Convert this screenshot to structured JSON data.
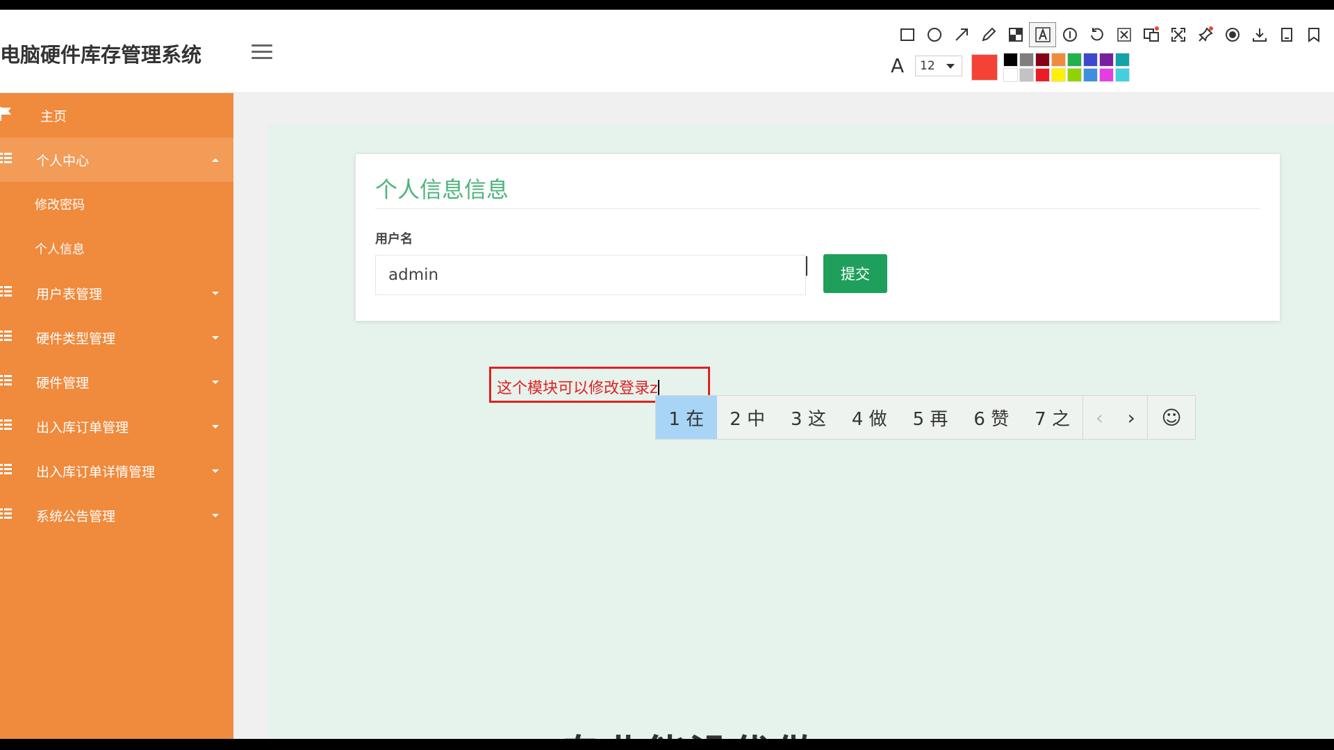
{
  "header": {
    "app_title": "电脑硬件库存管理系统"
  },
  "sidebar": {
    "items": [
      {
        "label": "主页"
      },
      {
        "label": "个人中心",
        "children": [
          "修改密码",
          "个人信息"
        ]
      },
      {
        "label": "用户表管理"
      },
      {
        "label": "硬件类型管理"
      },
      {
        "label": "硬件管理"
      },
      {
        "label": "出入库订单管理"
      },
      {
        "label": "出入库订单详情管理"
      },
      {
        "label": "系统公告管理"
      }
    ]
  },
  "form": {
    "title": "个人信息信息",
    "username_label": "用户名",
    "username_value": "admin",
    "submit_label": "提交"
  },
  "annotation": {
    "text": "这个模块可以修改登录z",
    "font_size": "12",
    "current_color": "#f44336",
    "palette": [
      "#000000",
      "#7f7f7f",
      "#880015",
      "#f08a3c",
      "#22b14c",
      "#3f48cc",
      "#7a1ea1",
      "#12a3a8",
      "#ffffff",
      "#c3c3c3",
      "#ed1c24",
      "#fff200",
      "#8fd400",
      "#3f8fe0",
      "#e63ce6",
      "#40d0e0"
    ]
  },
  "ime": {
    "candidates": [
      "1 在",
      "2 中",
      "3 这",
      "4 做",
      "5 再",
      "6 赞",
      "7 之"
    ],
    "prev": "‹",
    "next": "›",
    "emoji": "☺"
  },
  "bottom_caption": "专业能没优做"
}
